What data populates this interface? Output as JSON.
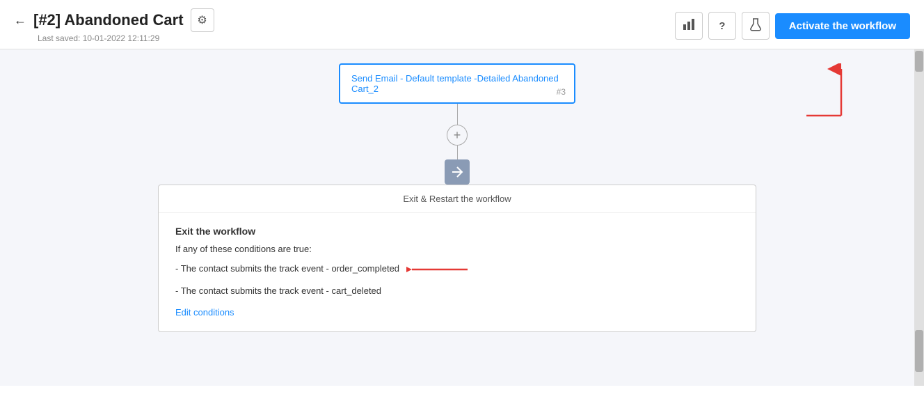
{
  "header": {
    "back_label": "←",
    "title": "[#2] Abandoned Cart",
    "gear_icon": "⚙",
    "last_saved_label": "Last saved: 10-01-2022 12:11:29",
    "icon_chart": "📊",
    "icon_help": "?",
    "icon_flask": "🧪",
    "activate_label": "Activate the workflow"
  },
  "canvas": {
    "send_email_node": {
      "label": "Send Email",
      "template_link": " - Default template -Detailed Abandoned Cart_2",
      "node_id": "#3"
    },
    "add_button_icon": "+",
    "exit_icon": "→",
    "exit_restart_label": "Exit & Restart the workflow",
    "exit_section": {
      "title": "Exit the workflow",
      "subtitle": "If any of these conditions are true:",
      "condition1": "- The contact submits the track event - order_completed",
      "condition2": "- The contact submits the track event - cart_deleted",
      "edit_link": "Edit conditions"
    }
  }
}
